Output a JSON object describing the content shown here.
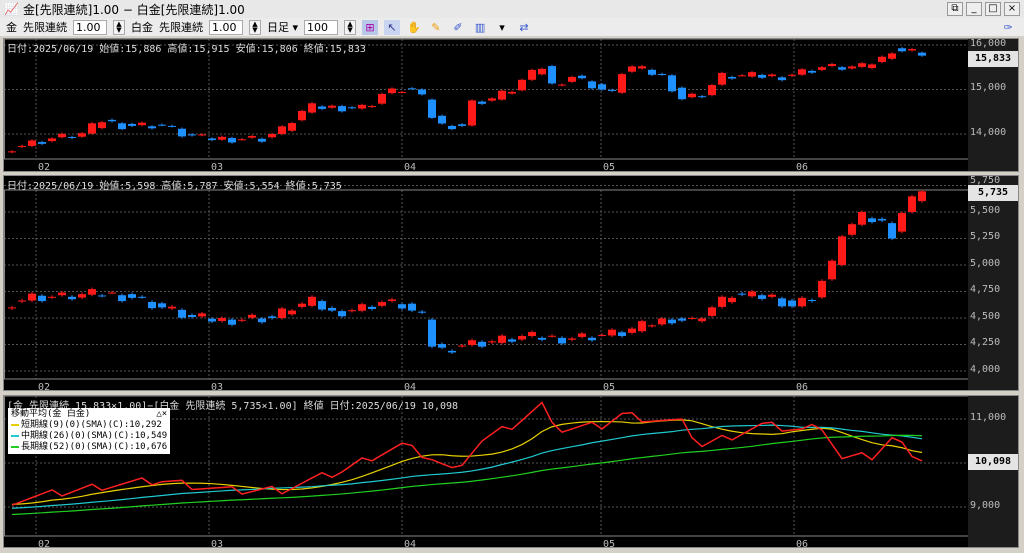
{
  "window": {
    "title": "金[先限連続]1.00 − 白金[先限連続]1.00",
    "buttons": [
      "⧉",
      "_",
      "□",
      "×"
    ]
  },
  "toolbar": {
    "sym1": "金",
    "contract1": "先限連続",
    "mult1": "1.00",
    "sym2": "白金",
    "contract2": "先限連続",
    "mult2": "1.00",
    "period": "日足 ▾",
    "count": "100",
    "icons": [
      "chart-settings-icon",
      "cursor-icon",
      "hand-icon",
      "pencil-icon",
      "line-tool-icon",
      "indicator-icon",
      "dropdown-icon",
      "compare-icon",
      "tool-settings-icon"
    ]
  },
  "colors": {
    "up": "#ff1a1a",
    "down": "#1e90ff",
    "short": "#e8d000",
    "mid": "#20c8d0",
    "long": "#20d020",
    "ratio": "#ff2020"
  },
  "months": [
    "02",
    "03",
    "04",
    "05",
    "06"
  ],
  "month_days": [
    2.4,
    19.7,
    39,
    58.9,
    78.2
  ],
  "panel1": {
    "header": "日付:2025/06/19 始値:15,886 高値:15,915 安値:15,806 終値:15,833",
    "ticks": [
      "16,000",
      "15,000",
      "14,000"
    ],
    "last": "15,833"
  },
  "panel2": {
    "header": "日付:2025/06/19 始値:5,598 高値:5,787 安値:5,554 終値:5,735",
    "ticks": [
      "5,750",
      "5,500",
      "5,250",
      "5,000",
      "4,750",
      "4,500",
      "4,250",
      "4,000"
    ],
    "last": "5,735"
  },
  "panel3": {
    "header": "[金 先限連続 15,833×1.00]−[白金 先限連続 5,735×1.00] 終値 日付:2025/06/19 10,098",
    "legend_title": "移動平均(金 白金)",
    "legend_icons": "△×",
    "legend": [
      "短期線(9)(0)(SMA)(C):10,292",
      "中期線(26)(0)(SMA)(C):10,549",
      "長期線(52)(0)(SMA)(C):10,676"
    ],
    "ticks": [
      "11,000",
      "9,000"
    ],
    "last": "10,098"
  },
  "chart_data": [
    {
      "type": "candlestick",
      "title": "金 先限連続 日足",
      "ylim": [
        13500,
        16200
      ],
      "days": 91,
      "close_path": [
        [
          0,
          13700
        ],
        [
          4,
          13900
        ],
        [
          7,
          14000
        ],
        [
          9,
          14300
        ],
        [
          11,
          14200
        ],
        [
          15,
          14200
        ],
        [
          17,
          14000
        ],
        [
          19,
          13900
        ],
        [
          25,
          13900
        ],
        [
          27,
          14100
        ],
        [
          29,
          14500
        ],
        [
          30,
          14600
        ],
        [
          35,
          14600
        ],
        [
          36,
          14700
        ],
        [
          37,
          14900
        ],
        [
          39,
          15000
        ],
        [
          40,
          15000
        ],
        [
          41,
          14800
        ],
        [
          42,
          14400
        ],
        [
          43,
          14200
        ],
        [
          45,
          14200
        ],
        [
          46,
          14700
        ],
        [
          48,
          14800
        ],
        [
          49,
          14900
        ],
        [
          50,
          15000
        ],
        [
          51,
          15200
        ],
        [
          53,
          15500
        ],
        [
          54,
          15100
        ],
        [
          56,
          15300
        ],
        [
          58,
          15100
        ],
        [
          60,
          14900
        ],
        [
          61,
          15400
        ],
        [
          62,
          15500
        ],
        [
          65,
          15300
        ],
        [
          67,
          14800
        ],
        [
          69,
          14900
        ],
        [
          71,
          15300
        ],
        [
          75,
          15300
        ],
        [
          77,
          15300
        ],
        [
          79,
          15400
        ],
        [
          81,
          15500
        ],
        [
          85,
          15500
        ],
        [
          87,
          15700
        ],
        [
          88,
          15900
        ],
        [
          91,
          15833
        ]
      ]
    },
    {
      "type": "candlestick",
      "title": "白金 先限連続 日足",
      "ylim": [
        3950,
        5800
      ],
      "days": 91,
      "close_path": [
        [
          0,
          4650
        ],
        [
          2,
          4700
        ],
        [
          5,
          4700
        ],
        [
          9,
          4730
        ],
        [
          12,
          4700
        ],
        [
          15,
          4600
        ],
        [
          18,
          4500
        ],
        [
          21,
          4480
        ],
        [
          24,
          4500
        ],
        [
          26,
          4500
        ],
        [
          28,
          4600
        ],
        [
          30,
          4650
        ],
        [
          32,
          4550
        ],
        [
          35,
          4600
        ],
        [
          37,
          4650
        ],
        [
          39,
          4620
        ],
        [
          41,
          4500
        ],
        [
          42,
          4250
        ],
        [
          43,
          4200
        ],
        [
          45,
          4250
        ],
        [
          48,
          4280
        ],
        [
          51,
          4320
        ],
        [
          55,
          4310
        ],
        [
          58,
          4330
        ],
        [
          61,
          4360
        ],
        [
          64,
          4450
        ],
        [
          66,
          4500
        ],
        [
          68,
          4470
        ],
        [
          70,
          4600
        ],
        [
          72,
          4720
        ],
        [
          74,
          4700
        ],
        [
          76,
          4700
        ],
        [
          78,
          4620
        ],
        [
          80,
          4700
        ],
        [
          82,
          5000
        ],
        [
          83,
          5300
        ],
        [
          85,
          5450
        ],
        [
          87,
          5400
        ],
        [
          88,
          5300
        ],
        [
          89,
          5500
        ],
        [
          91,
          5735
        ]
      ]
    },
    {
      "type": "line",
      "title": "金−白金 終値 spread with moving averages",
      "ylim": [
        8400,
        11700
      ],
      "days": 91,
      "ratio_path": [
        [
          0,
          9140
        ],
        [
          3,
          9250
        ],
        [
          9,
          9480
        ],
        [
          15,
          9600
        ],
        [
          22,
          9360
        ],
        [
          27,
          9400
        ],
        [
          33,
          9820
        ],
        [
          36,
          10150
        ],
        [
          39,
          10400
        ],
        [
          42,
          10100
        ],
        [
          44,
          9820
        ],
        [
          47,
          10500
        ],
        [
          50,
          10840
        ],
        [
          53,
          11300
        ],
        [
          55,
          10750
        ],
        [
          59,
          10850
        ],
        [
          61,
          11100
        ],
        [
          67,
          10900
        ],
        [
          69,
          10400
        ],
        [
          75,
          10850
        ],
        [
          79,
          10750
        ],
        [
          81,
          10850
        ],
        [
          83,
          10100
        ],
        [
          86,
          10150
        ],
        [
          88,
          10550
        ],
        [
          91,
          10098
        ]
      ],
      "ma_windows": [
        9,
        26,
        52
      ]
    }
  ]
}
